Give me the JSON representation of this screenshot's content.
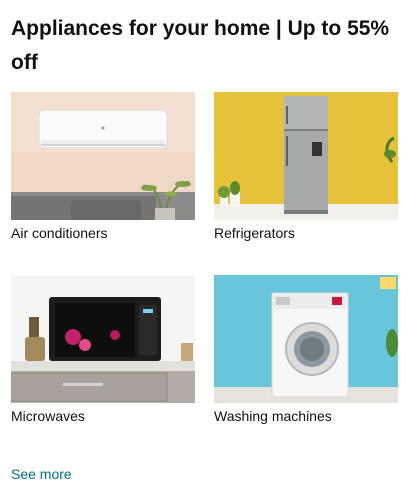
{
  "card": {
    "title": "Appliances for your home | Up to 55% off",
    "see_more": "See more",
    "link_color": "#007185"
  },
  "tiles": [
    {
      "label": "Air conditioners",
      "icon": "air-conditioner-image"
    },
    {
      "label": "Refrigerators",
      "icon": "refrigerator-image"
    },
    {
      "label": "Microwaves",
      "icon": "microwave-image"
    },
    {
      "label": "Washing machines",
      "icon": "washing-machine-image"
    }
  ]
}
